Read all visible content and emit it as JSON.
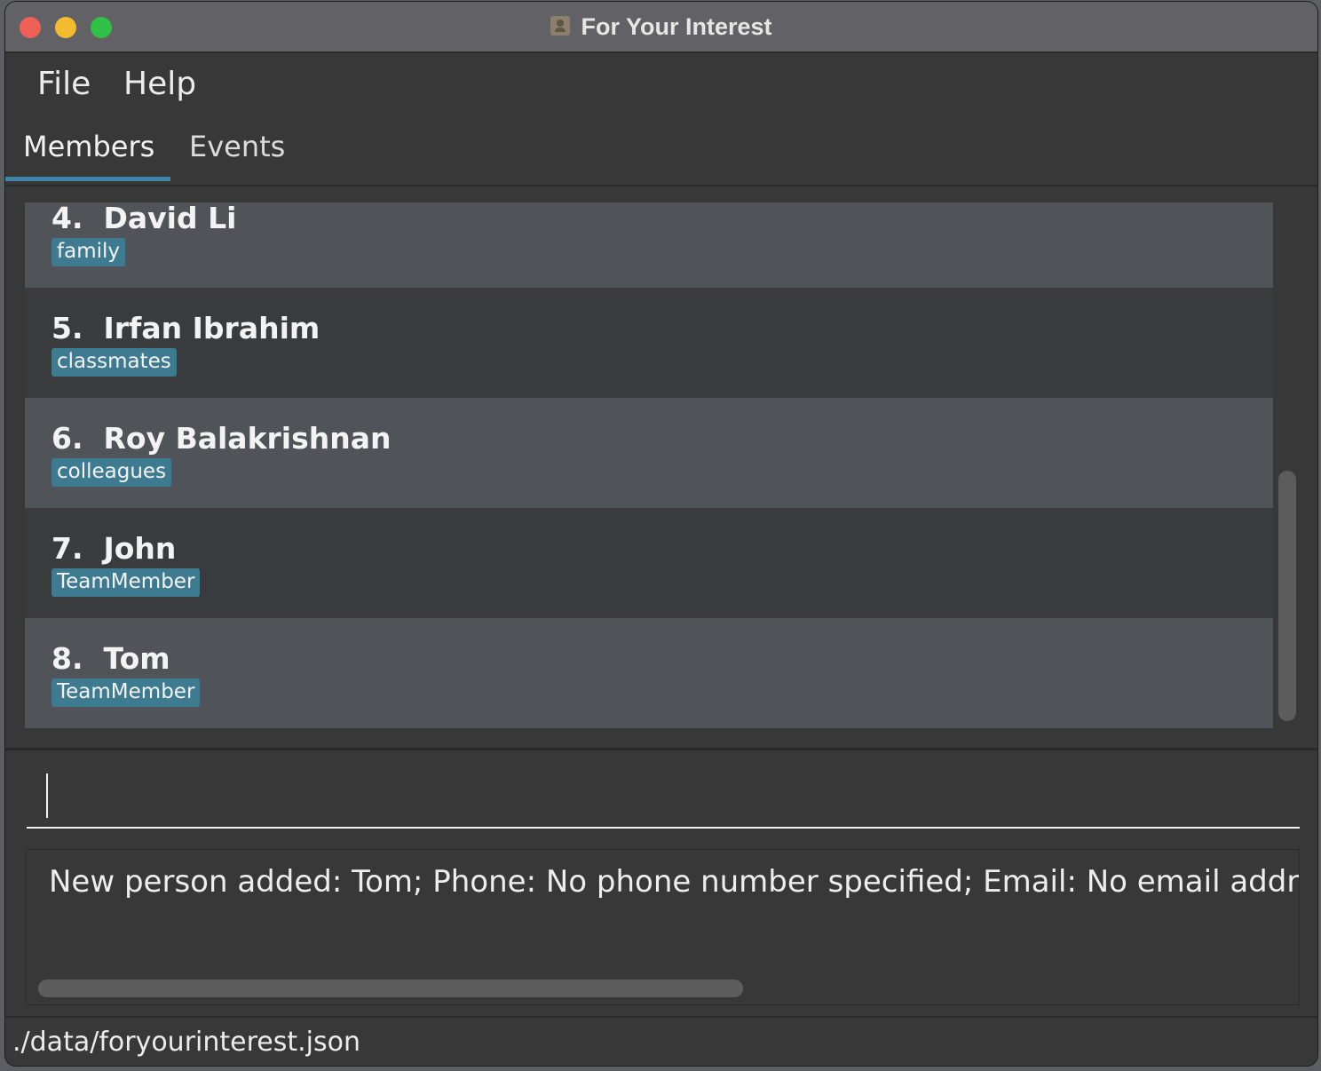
{
  "window": {
    "title": "For Your Interest"
  },
  "menu": {
    "items": [
      "File",
      "Help"
    ]
  },
  "tabs": {
    "items": [
      "Members",
      "Events"
    ],
    "active": "Members"
  },
  "members": [
    {
      "index": "4.",
      "name": "David Li",
      "tag": "family"
    },
    {
      "index": "5.",
      "name": "Irfan Ibrahim",
      "tag": "classmates"
    },
    {
      "index": "6.",
      "name": "Roy Balakrishnan",
      "tag": "colleagues"
    },
    {
      "index": "7.",
      "name": "John",
      "tag": "TeamMember"
    },
    {
      "index": "8.",
      "name": "Tom",
      "tag": "TeamMember"
    }
  ],
  "command": {
    "value": ""
  },
  "result": {
    "text": "New person added: Tom; Phone: No phone number specified; Email: No email address spe"
  },
  "status": {
    "path": "./data/foryourinterest.json"
  },
  "colors": {
    "tag": "#3e7b91",
    "tab_underline": "#3d86a6",
    "row_odd": "#505458",
    "row_even": "#3a3b3d"
  }
}
